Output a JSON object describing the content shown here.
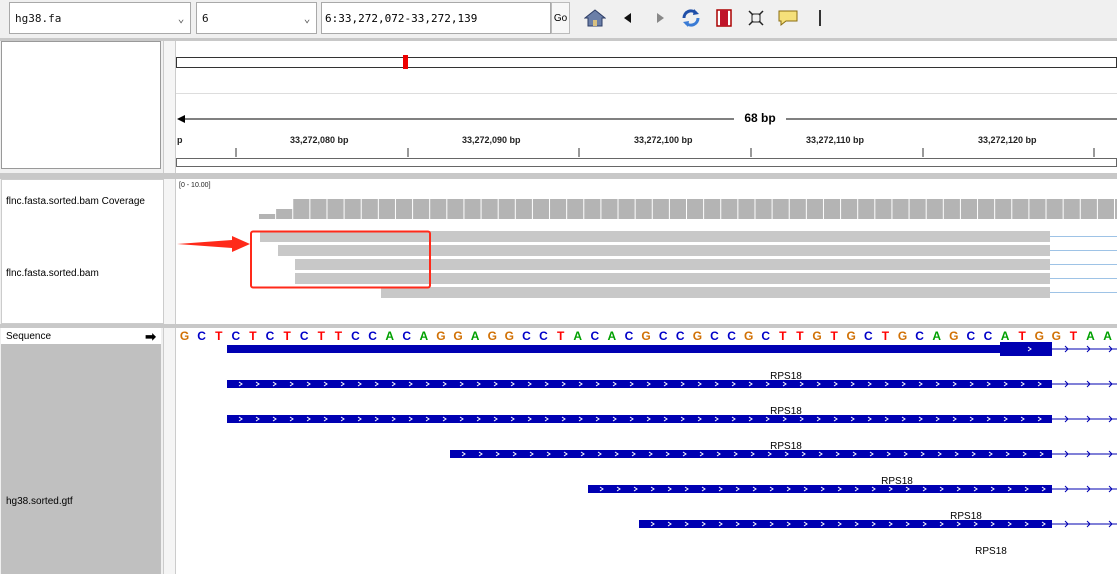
{
  "toolbar": {
    "genome": "hg38.fa",
    "chromosome": "6",
    "locus": "6:33,272,072-33,272,139",
    "go_label": "Go",
    "buttons": [
      "home-icon",
      "back-icon",
      "forward-icon",
      "refresh-icon",
      "roi-icon",
      "fit-window-icon",
      "popup-text-icon"
    ]
  },
  "ruler": {
    "span_label": "68 bp",
    "left_tick_label": "p",
    "tick_labels": [
      "33,272,080 bp",
      "33,272,090 bp",
      "33,272,100 bp",
      "33,272,110 bp",
      "33,272,120 bp"
    ]
  },
  "tracks": {
    "coverage_name": "flnc.fasta.sorted.bam Coverage",
    "coverage_range": "[0 - 10.00]",
    "coverage_values": [
      1,
      2,
      4,
      4,
      4,
      4,
      4,
      4,
      4,
      4,
      4,
      4,
      4,
      4,
      4,
      4,
      4,
      4,
      4,
      4,
      4,
      4,
      4,
      4,
      4,
      4,
      4,
      4,
      4,
      4,
      4,
      4,
      4,
      4,
      4,
      4,
      4,
      4,
      4,
      4,
      4,
      4,
      4,
      4,
      4,
      4,
      4,
      4,
      4,
      4,
      4
    ],
    "bam_name": "flnc.fasta.sorted.bam",
    "sequence_name": "Sequence",
    "gtf_name": "hg38.sorted.gtf"
  },
  "sequence": "GCTCTCTCTTCCACAGGAGGCCTACACGCCGCCGCTTGTGCTGCAGCCATGGTAA",
  "genes": [
    "RPS18",
    "RPS18",
    "RPS18",
    "RPS18",
    "RPS18",
    "RPS18"
  ],
  "colors": {
    "A": "#00a000",
    "C": "#0000c8",
    "G": "#d17105",
    "T": "#ff0000",
    "feature": "#0000b2",
    "read": "#c8c8c8",
    "coverage": "#b4b4b4",
    "annotation": "#ff0000"
  }
}
